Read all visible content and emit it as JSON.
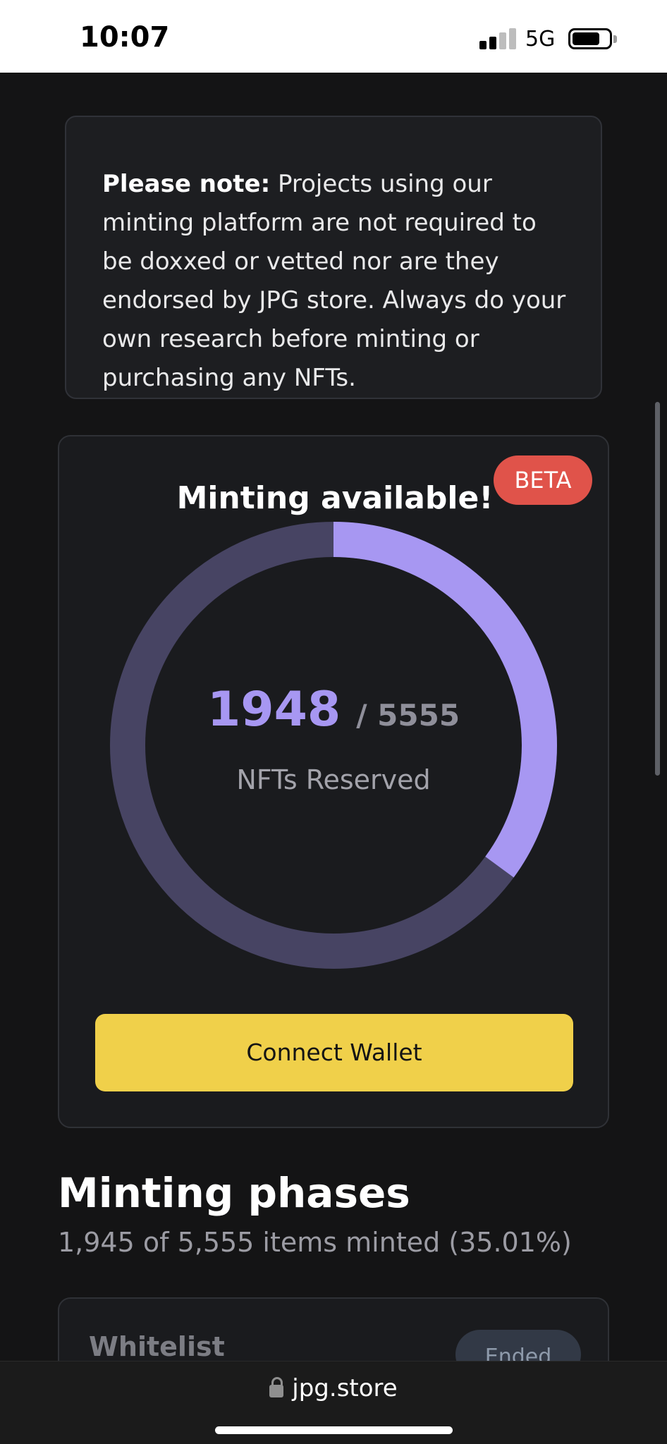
{
  "status_bar": {
    "time": "10:07",
    "network": "5G",
    "battery_level": 0.75,
    "signal_bars_active": 2
  },
  "notice": {
    "bold_prefix": "Please note:",
    "text": " Projects using our minting platform are not required to be doxxed or vetted nor are they endorsed by JPG store. Always do your own research before minting or purchasing any NFTs."
  },
  "mint": {
    "title": "Minting available!",
    "badge": "BETA",
    "reserved": "1948",
    "total": "/ 5555",
    "label": "NFTs Reserved",
    "reserved_fraction": 0.3507,
    "ring_colors": {
      "filled": "#a797f2",
      "track": "#474463"
    },
    "connect_button": "Connect Wallet"
  },
  "phases": {
    "title": "Minting phases",
    "summary": "1,945 of 5,555 items minted (35.01%)",
    "items": [
      {
        "name": "Whitelist",
        "status": "Ended"
      }
    ]
  },
  "browser": {
    "url": "jpg.store"
  }
}
